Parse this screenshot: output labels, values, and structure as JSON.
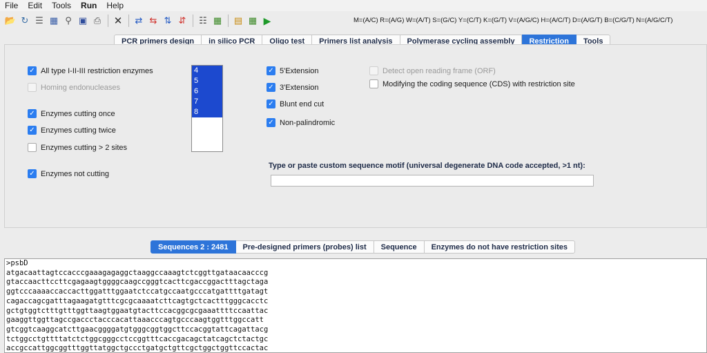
{
  "menu": {
    "file": "File",
    "edit": "Edit",
    "tools": "Tools",
    "run": "Run",
    "help": "Help"
  },
  "toolbar": {
    "icons": [
      "open-folder-icon",
      "refresh-icon",
      "list-icon",
      "save-all-icon",
      "zoom-icon",
      "save-icon",
      "print-icon",
      "close-icon",
      "primer-design-icon",
      "pcr-icon",
      "reverse-icon",
      "primer-pair-icon",
      "table-icon",
      "grid-icon",
      "assembly-icon",
      "grid2-icon",
      "run-icon"
    ],
    "codes": "M=(A/C) R=(A/G) W=(A/T) S=(G/C) Y=(C/T) K=(G/T) V=(A/G/C) H=(A/C/T) D=(A/G/T) B=(C/G/T) N=(A/G/C/T)"
  },
  "top_tabs": [
    "PCR primers design",
    "in silico PCR",
    "Oligo test",
    "Primers list analysis",
    "Polymerase cycling assembly",
    "Restriction",
    "Tools"
  ],
  "top_tabs_active": "Restriction",
  "restriction": {
    "all_type": "All type I-II-III restriction enzymes",
    "homing": "Homing endonucleases",
    "cutting_once": "Enzymes cutting once",
    "cutting_twice": "Enzymes cutting twice",
    "cutting_more": "Enzymes cutting > 2 sites",
    "not_cutting": "Enzymes not cutting",
    "site_lengths": [
      "4",
      "5",
      "6",
      "7",
      "8"
    ],
    "ext5": "5'Extension",
    "ext3": "3'Extension",
    "blunt": "Blunt end cut",
    "nonpal": "Non-palindromic",
    "orf": "Detect open reading frame (ORF)",
    "cds": "Modifying the coding sequence (CDS) with restriction site",
    "motif_label": "Type or paste custom sequence motif (universal degenerate DNA code accepted, >1 nt):",
    "motif_value": ""
  },
  "bottom_tabs": [
    "Sequences 2 : 2481",
    "Pre-designed primers (probes) list",
    "Sequence",
    "Enzymes do not have restriction sites"
  ],
  "bottom_tabs_active": "Sequences 2 : 2481",
  "sequence_lines": [
    ">psbD",
    "atgacaattagtccacccgaaagagaggctaaggccaaagtctcggttgataacaacccg",
    "gtaccaacttccttcgagaagtggggcaagccgggtcacttcgaccggactttagctaga",
    "ggtcccaaaaccaccacttggatttggaatctccatgccaatgcccatgattttgatagt",
    "cagaccagcgatttagaagatgtttcgcgcaaaatcttcagtgctcactttgggcacctc",
    "gctgtggtctttgtttggttaagtggaatgtacttccacggcgcgaaattttccaattac",
    "gaaggttggttagccgaccctacccacattaaacccagtgcccaagtggtttggccatt",
    "gtcggtcaaggcatcttgaacggggatgtgggcggtggcttccacggtattcagattacg",
    "tctggcctgttttatctctggcgggcctccggtttcaccgacagctatcagctctactgc",
    "accgccattggcggtttggttatggctgccctgatgctgttcgctggctggttccactac"
  ]
}
